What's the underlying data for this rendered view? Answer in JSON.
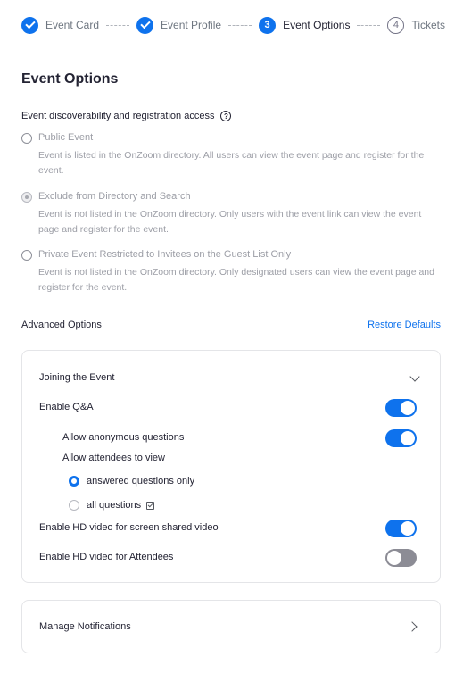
{
  "stepper": {
    "steps": [
      {
        "number": "1",
        "label": "Event Card",
        "state": "done"
      },
      {
        "number": "2",
        "label": "Event Profile",
        "state": "done"
      },
      {
        "number": "3",
        "label": "Event Options",
        "state": "active"
      },
      {
        "number": "4",
        "label": "Tickets",
        "state": "todo"
      }
    ]
  },
  "page_title": "Event Options",
  "access": {
    "label": "Event discoverability and registration access",
    "help_icon": "question-circle-icon",
    "options": [
      {
        "title": "Public Event",
        "desc": "Event is listed in the OnZoom directory. All users can view the event page and register for the event.",
        "checked": false
      },
      {
        "title": "Exclude from Directory and Search",
        "desc": "Event is not listed in the OnZoom directory. Only users with the event link can view the event page and register for the event.",
        "checked": true
      },
      {
        "title": "Private Event Restricted to Invitees on the Guest List Only",
        "desc": "Event is not listed in the OnZoom directory. Only designated users can view the event page and register for the event.",
        "checked": false
      }
    ]
  },
  "advanced": {
    "title": "Advanced Options",
    "restore_label": "Restore Defaults"
  },
  "joining": {
    "title": "Joining the Event",
    "enable_qa": "Enable Q&A",
    "enable_qa_on": true,
    "allow_anonymous": "Allow anonymous questions",
    "allow_anonymous_on": true,
    "allow_view": "Allow attendees to view",
    "view_options": [
      {
        "label": "answered questions only",
        "checked": true
      },
      {
        "label": "all questions",
        "checked": false
      }
    ],
    "hd_screen": "Enable HD video for screen shared video",
    "hd_screen_on": true,
    "hd_attendees": "Enable HD video for Attendees",
    "hd_attendees_on": false
  },
  "notifications": {
    "title": "Manage Notifications"
  },
  "colors": {
    "accent": "#0e72ed",
    "toggle_off": "#8c8c95"
  }
}
